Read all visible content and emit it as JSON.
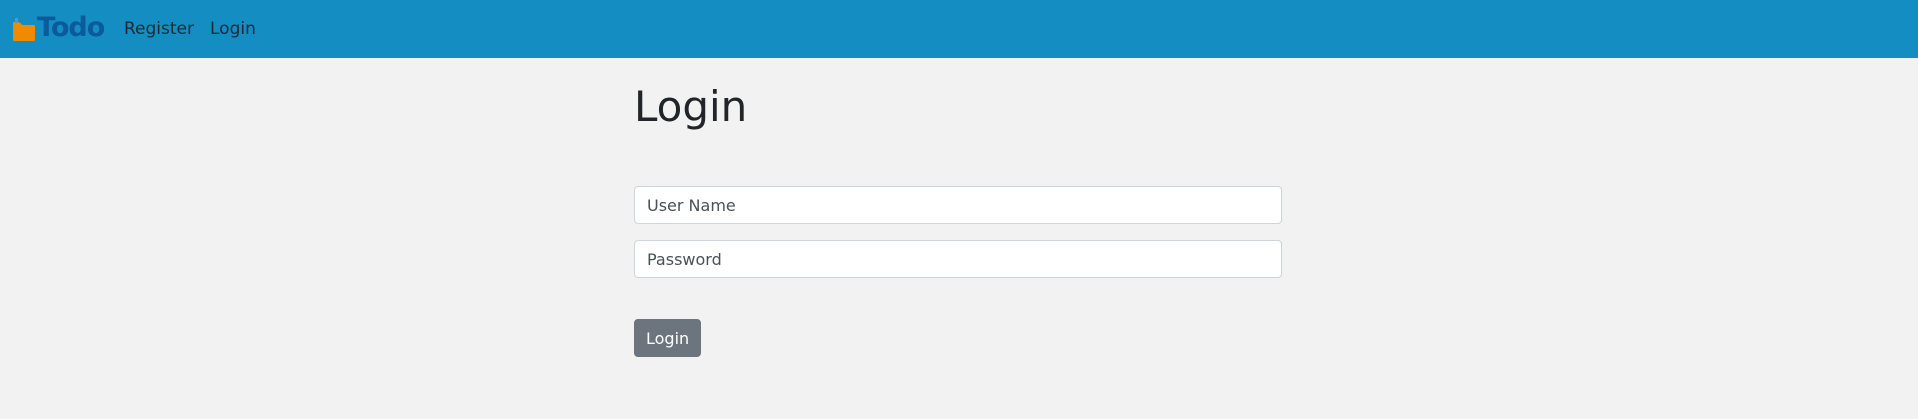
{
  "navbar": {
    "brand_logo_icon": "folder-icon",
    "brand_text": "Todo",
    "links": [
      {
        "label": "Register"
      },
      {
        "label": "Login"
      }
    ],
    "colors": {
      "background": "#138dc2",
      "brand_text": "#0b5a9c",
      "logo_folder": "#f08a00"
    }
  },
  "main": {
    "title": "Login",
    "form": {
      "username_placeholder": "User Name",
      "username_value": "",
      "password_placeholder": "Password",
      "password_value": "",
      "submit_label": "Login"
    },
    "colors": {
      "page_background": "#f2f2f2",
      "button_background": "#6c757d"
    }
  }
}
